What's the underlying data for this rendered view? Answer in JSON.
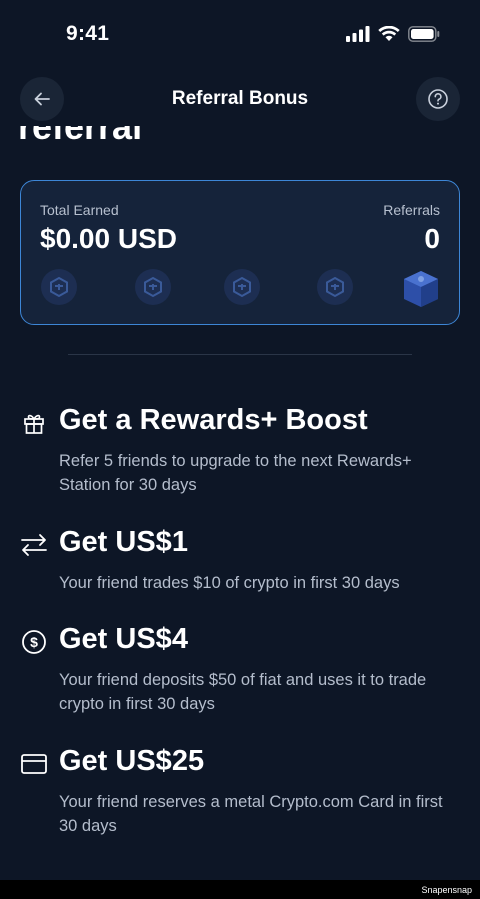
{
  "status": {
    "time": "9:41"
  },
  "nav": {
    "title": "Referral Bonus"
  },
  "scrolled_heading": "referral",
  "earn_card": {
    "total_label": "Total Earned",
    "total_value": "$0.00 USD",
    "referrals_label": "Referrals",
    "referrals_value": "0"
  },
  "benefits": [
    {
      "icon": "gift-icon",
      "title": "Get a Rewards+ Boost",
      "desc": "Refer 5 friends to upgrade to the next Rewards+ Station for 30 days"
    },
    {
      "icon": "swap-arrows-icon",
      "title": "Get US$1",
      "desc": "Your friend trades $10 of crypto in first 30 days"
    },
    {
      "icon": "dollar-coin-icon",
      "title": "Get US$4",
      "desc": "Your friend deposits $50 of fiat and uses it to trade crypto in first 30 days"
    },
    {
      "icon": "card-icon",
      "title": "Get US$25",
      "desc": "Your friend reserves a metal Crypto.com Card in first 30 days"
    }
  ],
  "watermark": "Snapensnap",
  "colors": {
    "background": "#0d1626",
    "card_border": "#3d86d6",
    "badge": "#1d2e52"
  }
}
